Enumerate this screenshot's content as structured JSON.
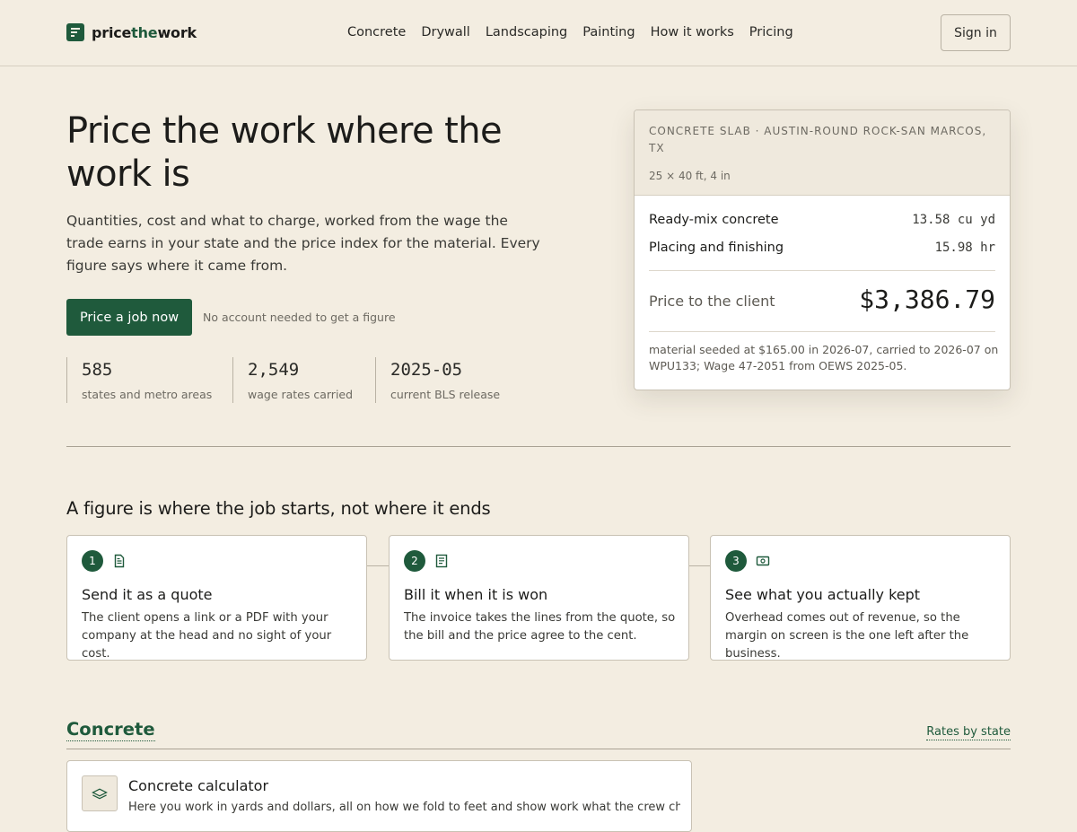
{
  "brand": {
    "name_pre": "price",
    "name_accent": "the",
    "name_post": "work",
    "color": "#1f5a3c"
  },
  "nav": {
    "items": [
      "Concrete",
      "Drywall",
      "Landscaping",
      "Painting",
      "How it works",
      "Pricing"
    ],
    "signin": "Sign in"
  },
  "hero": {
    "title": "Price the work where the work is",
    "subtitle": "Quantities, cost and what to charge, worked from the wage the trade earns in your state and the price index for the material. Every figure says where it came from.",
    "cta": "Price a job now",
    "cta_note": "No account needed to get a figure",
    "stats": [
      {
        "value": "585",
        "label": "states and metro areas"
      },
      {
        "value": "2,549",
        "label": "wage rates carried"
      },
      {
        "value": "2025-05",
        "label": "current BLS release"
      }
    ]
  },
  "estimate": {
    "kicker": "CONCRETE SLAB · AUSTIN-ROUND ROCK-SAN MARCOS, TX",
    "dims": "25 × 40 ft, 4 in",
    "lines": [
      {
        "label": "Ready-mix concrete",
        "qty": "13.58 cu yd"
      },
      {
        "label": "Placing and finishing",
        "qty": "15.98 hr"
      }
    ],
    "price_label": "Price to the client",
    "price": "$3,386.79",
    "footnote": "material seeded at $165.00 in 2026-07, carried to 2026-07 on WPU133; Wage 47-2051 from OEWS 2025-05."
  },
  "steps": {
    "title": "A figure is where the job starts, not where it ends",
    "items": [
      {
        "num": "1",
        "icon": "document-icon",
        "title": "Send it as a quote",
        "desc": "The client opens a link or a PDF with your company at the head and no sight of your cost."
      },
      {
        "num": "2",
        "icon": "invoice-icon",
        "title": "Bill it when it is won",
        "desc": "The invoice takes the lines from the quote, so the bill and the price agree to the cent."
      },
      {
        "num": "3",
        "icon": "cash-icon",
        "title": "See what you actually kept",
        "desc": "Overhead comes out of revenue, so the margin on screen is the one left after the business."
      }
    ]
  },
  "concrete": {
    "title": "Concrete",
    "link": "Rates by state",
    "calc_title": "Concrete calculator",
    "calc_desc": "Here you work in yards and dollars, all on how we fold to feet and show work what the crew charges at"
  }
}
